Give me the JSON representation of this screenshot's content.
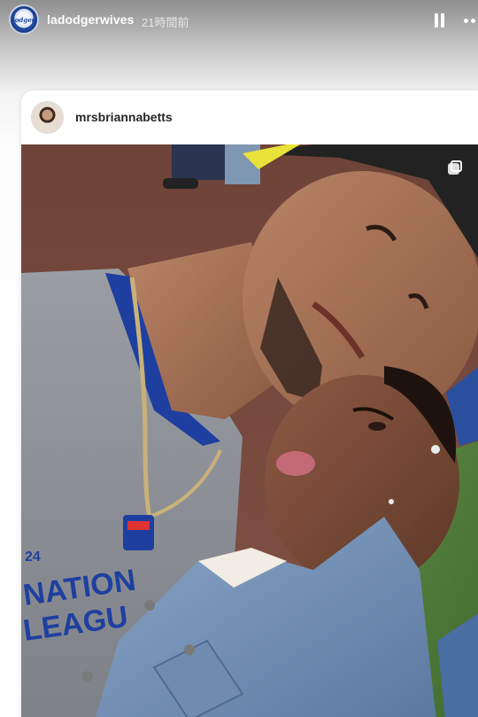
{
  "story": {
    "account": {
      "username": "ladodgerwives",
      "avatar_icon": "dodgers-logo-icon",
      "avatar_text": "Dodgers",
      "timestamp": "21時間前"
    },
    "controls": {
      "pause_icon": "pause-icon",
      "more_icon": "more-options-icon"
    },
    "shared_post": {
      "username": "mrsbriannabetts",
      "avatar_icon": "profile-photo",
      "media": {
        "type": "photo",
        "multi_icon": "carousel-icon",
        "shirt_text": [
          "24",
          "NATION",
          "LEAGU"
        ],
        "colors": {
          "jersey_gray": "#8f9398",
          "dodger_blue": "#1f3fa0",
          "denim": "#6f8fb8",
          "field_dirt": "#7a4b3f",
          "field_grass": "#4f7a3a"
        }
      }
    }
  }
}
